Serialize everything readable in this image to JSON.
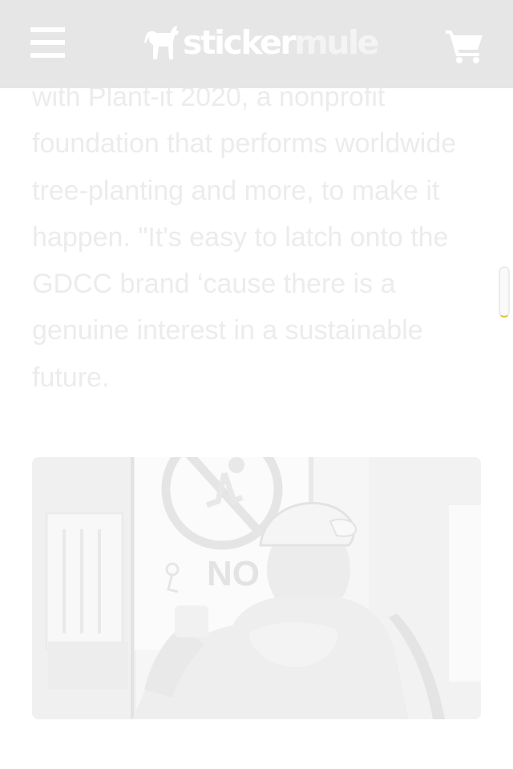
{
  "header": {
    "logo": {
      "part1": "sticker",
      "part2": "mule"
    },
    "menu_icon": "hamburger-menu-icon",
    "cart_icon": "shopping-cart-icon"
  },
  "article": {
    "paragraph": "with Plant-it 2020, a nonprofit foundation that performs worldwide tree-planting and more, to make it happen. \"It's easy to latch onto the GDCC brand ‘cause there is a genuine interest in a sustainable future."
  },
  "photo": {
    "sign_text": "NO"
  },
  "colors": {
    "header_bg": "#e6e6e6",
    "text": "#ececec",
    "scroll_accent": "#e8c233"
  }
}
